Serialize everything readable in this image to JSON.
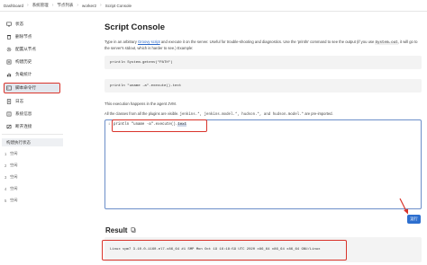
{
  "breadcrumb": [
    "Dashboard",
    "系统管理",
    "节点列表",
    "worker2",
    "Script Console"
  ],
  "sidebar": {
    "items": [
      {
        "label": "状态",
        "icon": "monitor-icon"
      },
      {
        "label": "删除节点",
        "icon": "trash-icon"
      },
      {
        "label": "配置从节点",
        "icon": "gear-icon"
      },
      {
        "label": "构建历史",
        "icon": "history-icon"
      },
      {
        "label": "负载统计",
        "icon": "chart-icon"
      },
      {
        "label": "脚本命令行",
        "icon": "terminal-icon",
        "active": true
      },
      {
        "label": "日志",
        "icon": "log-icon"
      },
      {
        "label": "系统信息",
        "icon": "info-icon"
      },
      {
        "label": "断开连接",
        "icon": "disconnect-icon"
      }
    ],
    "executor_title": "构建执行状态",
    "executors": [
      {
        "num": "1",
        "status": "空闲"
      },
      {
        "num": "2",
        "status": "空闲"
      },
      {
        "num": "3",
        "status": "空闲"
      },
      {
        "num": "4",
        "status": "空闲"
      },
      {
        "num": "5",
        "status": "空闲"
      }
    ]
  },
  "main": {
    "title": "Script Console",
    "intro_a": "Type in an arbitrary ",
    "intro_link": "Groovy script",
    "intro_b": " and execute it on the server. Useful for trouble-shooting and diagnostics. Use the 'println' command to see the output (if you use ",
    "intro_code": "System.out",
    "intro_c": ", it will go to the server's stdout, which is harder to see.) Example:",
    "example1": "println System.getenv(\"PATH\")",
    "example2": "println \"uname -a\".execute().text",
    "note1": "This execution happens in the agent JVM.",
    "note2_a": "All the classes from all the plugins are visible. ",
    "note2_code": "jenkins.*, jenkins.model.*, hudson.*, and hudson.model.*",
    "note2_b": " are pre-imported.",
    "editor_linenum": "1",
    "editor_code": "println \"uname -a\".execute().",
    "editor_selected": "text",
    "run_label": "运行",
    "result_title": "Result",
    "result_text": "Linux vpm7 3.10.0-1160.el7.x86_64 #1 SMP Mon Oct 19 16:18:59 UTC 2020 x86_64 x86_64 x86_64 GNU/Linux"
  },
  "colors": {
    "highlight": "#d9342b",
    "accent": "#2d6fcf"
  }
}
